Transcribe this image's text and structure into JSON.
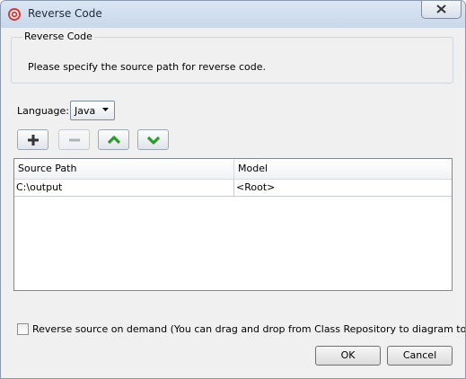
{
  "window": {
    "title": "Reverse Code"
  },
  "group": {
    "title": "Reverse Code",
    "description": "Please specify the source path for reverse code."
  },
  "language": {
    "label": "Language:",
    "selected": "Java"
  },
  "toolbar": {
    "add": "plus-icon",
    "remove": "minus-icon",
    "move_up": "chevron-up-icon",
    "move_down": "chevron-down-icon"
  },
  "table": {
    "columns": [
      "Source Path",
      "Model"
    ],
    "rows": [
      [
        "C:\\output",
        "<Root>"
      ]
    ]
  },
  "options": {
    "on_demand_label": "Reverse source on demand (You can drag and drop from Class Repository to diagram to reverse)"
  },
  "buttons": {
    "ok": "OK",
    "cancel": "Cancel"
  },
  "colors": {
    "accent_green": "#3aa23a",
    "app_icon_red": "#d23b3b"
  }
}
